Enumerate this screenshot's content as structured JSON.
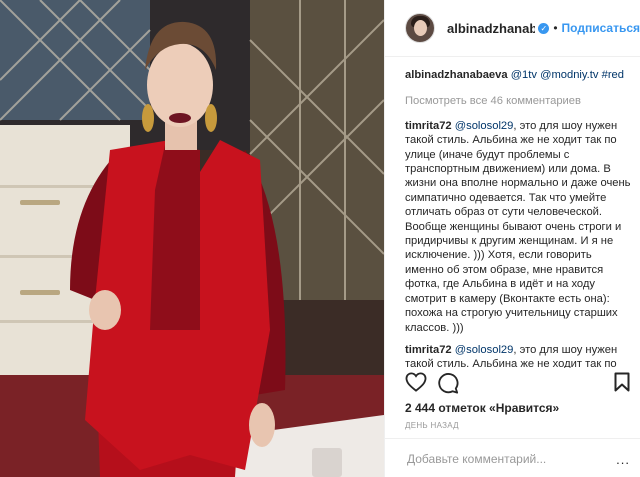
{
  "header": {
    "username": "albinadzhanabae...",
    "follow_label": "Подписаться",
    "separator": "•"
  },
  "caption": {
    "username": "albinadzhanabaeva",
    "tags": "@1tv @modniy.tv #red"
  },
  "view_all_comments": "Посмотреть все 46 комментариев",
  "comments": [
    {
      "username": "timrita72",
      "mention": "@solosol29",
      "text": ", это для шоу нужен такой стиль. Альбина же не ходит так по улице (иначе будут проблемы с транспортным движением) или дома. В жизни она вполне нормально и даже очень симпатично одевается. Так что умейте отличать образ от сути человеческой. Вообще женщины бывают очень строги и придирчивы к другим женщинам. И я не исключение. ))) Хотя, если говорить именно об этом образе, мне нравится фотка, где Альбина в идёт и на ходу смотрит в камеру (Вконтакте есть она): похожа на строгую учительницу старших классов. )))"
    },
    {
      "username": "timrita72",
      "mention": "@solosol29",
      "text": ", это для шоу нужен такой стиль. Альбина же не ходит так по"
    }
  ],
  "likes_text": "2 444 отметок «Нравится»",
  "time_text": "день назад",
  "add_comment_placeholder": "Добавьте комментарий...",
  "menu_icon": "...",
  "colors": {
    "accent": "#3897f0",
    "suit_red": "#c8121e",
    "text": "#262626",
    "muted": "#999999"
  }
}
